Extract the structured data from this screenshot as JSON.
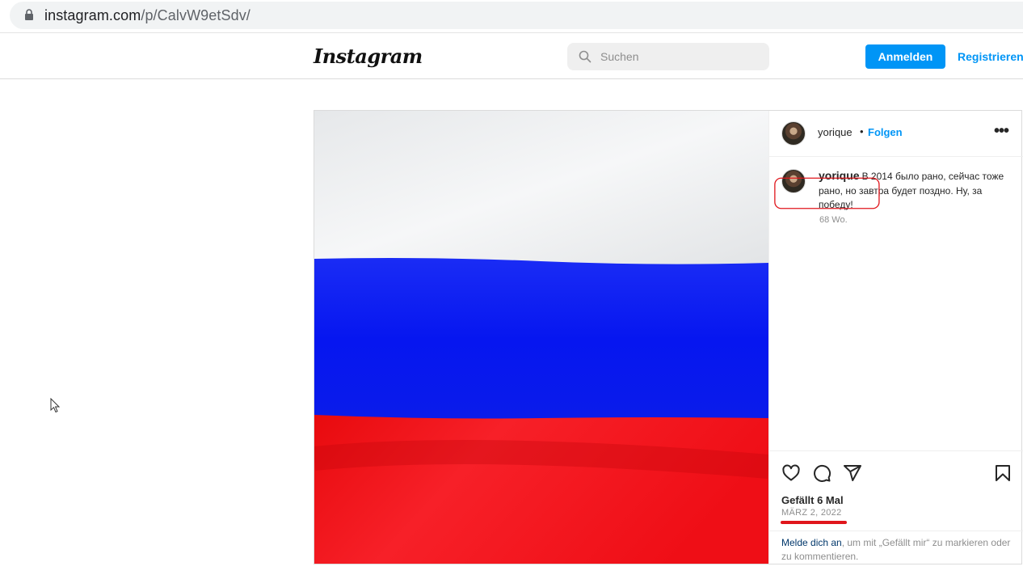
{
  "browser": {
    "url_host": "instagram.com",
    "url_path": "/p/CalvW9etSdv/"
  },
  "header": {
    "logo": "Instagram",
    "search_placeholder": "Suchen",
    "login_label": "Anmelden",
    "register_label": "Registrieren"
  },
  "post": {
    "username": "yorique",
    "separator": "•",
    "follow_label": "Folgen",
    "more_label": "•••",
    "caption": {
      "username": "yorique",
      "text": "В 2014 было рано, сейчас тоже рано, но завтра будет поздно. Ну, за победу!",
      "age": "68 Wo."
    },
    "likes": "Gefällt 6 Mal",
    "date": "MÄRZ 2, 2022",
    "login_link": "Melde dich an",
    "login_text": ", um mit „Gefällt mir“ zu markieren oder zu kommentieren."
  },
  "colors": {
    "accent": "#0095f6",
    "annotation": "#e0161c",
    "flag_white": "#eef0f2",
    "flag_blue": "#0a1ef2",
    "flag_red": "#f20a12"
  },
  "icons": [
    "lock-icon",
    "search-icon",
    "heart-icon",
    "comment-icon",
    "share-icon",
    "bookmark-icon",
    "more-icon",
    "cursor-icon"
  ]
}
